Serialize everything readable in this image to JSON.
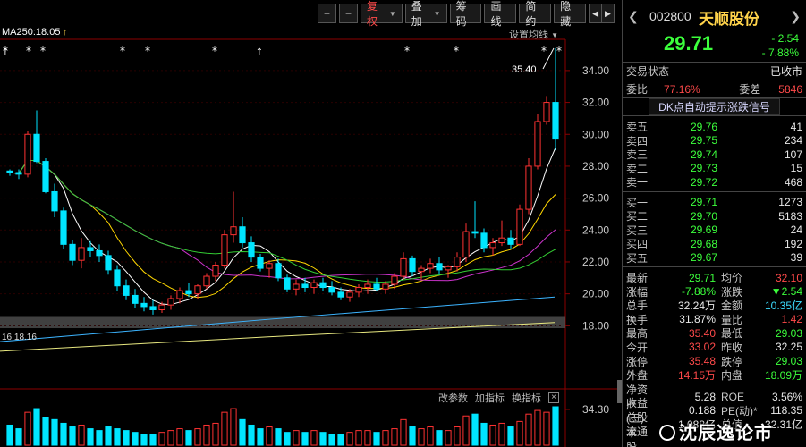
{
  "toolbar": {
    "plus": "+",
    "minus": "−",
    "fuquan": "复权",
    "diejia": "叠加",
    "chouma": "筹码",
    "huaxian": "画线",
    "jianyue": "简约",
    "yincang": "隐藏",
    "prev": "◀",
    "next": "▶"
  },
  "ma": {
    "label": "MA250:18.05",
    "settings": "设置均线"
  },
  "chart_data": {
    "type": "candlestick",
    "ylim": [
      16.0,
      35.9
    ],
    "price_ticks": [
      "34.00",
      "32.00",
      "30.00",
      "28.00",
      "26.00",
      "24.00",
      "22.00",
      "20.00",
      "18.00"
    ],
    "tick_values": [
      34,
      32,
      30,
      28,
      26,
      24,
      22,
      20,
      18
    ],
    "high_annotation": "35.40",
    "low_annotation": "16.18.16",
    "vol_label": "34.30",
    "candles": [
      [
        27.7,
        27.8,
        27.4,
        27.6
      ],
      [
        27.6,
        27.8,
        27.2,
        27.5
      ],
      [
        27.5,
        30.2,
        27.3,
        30.0
      ],
      [
        30.0,
        31.5,
        28.2,
        28.3
      ],
      [
        28.3,
        28.5,
        26.3,
        26.4
      ],
      [
        26.4,
        26.9,
        24.8,
        25.2
      ],
      [
        25.2,
        25.4,
        22.8,
        23.1
      ],
      [
        23.1,
        23.4,
        21.8,
        22.1
      ],
      [
        22.1,
        23.5,
        21.6,
        22.9
      ],
      [
        22.9,
        23.3,
        22.3,
        22.7
      ],
      [
        22.7,
        23.1,
        22.0,
        22.4
      ],
      [
        22.4,
        22.7,
        21.2,
        21.5
      ],
      [
        21.5,
        21.8,
        20.2,
        20.5
      ],
      [
        20.5,
        20.9,
        19.6,
        19.9
      ],
      [
        19.9,
        20.3,
        19.1,
        19.4
      ],
      [
        19.4,
        19.8,
        18.9,
        19.2
      ],
      [
        19.2,
        19.6,
        18.7,
        19.0
      ],
      [
        19.0,
        19.5,
        18.8,
        19.3
      ],
      [
        19.3,
        19.9,
        19.0,
        19.7
      ],
      [
        19.7,
        20.4,
        19.4,
        20.2
      ],
      [
        20.2,
        20.7,
        19.8,
        20.0
      ],
      [
        20.0,
        20.6,
        19.7,
        20.5
      ],
      [
        20.5,
        21.3,
        20.3,
        21.1
      ],
      [
        21.1,
        22.0,
        20.8,
        21.8
      ],
      [
        21.8,
        24.0,
        21.6,
        23.7
      ],
      [
        23.7,
        26.4,
        23.2,
        24.2
      ],
      [
        24.2,
        24.8,
        22.9,
        23.2
      ],
      [
        23.2,
        23.6,
        22.0,
        22.3
      ],
      [
        22.3,
        22.5,
        21.4,
        21.6
      ],
      [
        21.6,
        22.1,
        21.0,
        21.9
      ],
      [
        21.9,
        22.2,
        20.8,
        21.0
      ],
      [
        21.0,
        21.2,
        20.1,
        20.3
      ],
      [
        20.3,
        20.9,
        19.9,
        20.6
      ],
      [
        20.6,
        21.0,
        20.1,
        20.4
      ],
      [
        20.4,
        20.9,
        20.0,
        20.7
      ],
      [
        20.7,
        21.0,
        20.2,
        20.4
      ],
      [
        20.4,
        20.8,
        19.9,
        20.1
      ],
      [
        20.1,
        20.4,
        19.6,
        19.8
      ],
      [
        19.8,
        20.3,
        19.5,
        20.1
      ],
      [
        20.1,
        20.6,
        19.8,
        20.4
      ],
      [
        20.4,
        20.9,
        20.0,
        20.6
      ],
      [
        20.6,
        21.0,
        20.2,
        20.3
      ],
      [
        20.3,
        20.8,
        20.0,
        20.6
      ],
      [
        20.6,
        21.3,
        20.3,
        21.1
      ],
      [
        21.1,
        22.6,
        20.9,
        22.2
      ],
      [
        22.2,
        22.4,
        21.1,
        21.4
      ],
      [
        21.4,
        21.8,
        20.9,
        21.6
      ],
      [
        21.6,
        22.2,
        21.3,
        21.9
      ],
      [
        21.9,
        22.3,
        21.2,
        21.5
      ],
      [
        21.5,
        21.8,
        21.0,
        21.7
      ],
      [
        21.7,
        22.6,
        21.4,
        22.3
      ],
      [
        22.3,
        24.4,
        22.0,
        23.9
      ],
      [
        23.9,
        25.8,
        23.5,
        23.8
      ],
      [
        23.8,
        24.1,
        22.6,
        22.9
      ],
      [
        22.9,
        23.5,
        22.4,
        23.2
      ],
      [
        23.2,
        24.6,
        23.0,
        23.5
      ],
      [
        23.5,
        24.0,
        22.8,
        23.1
      ],
      [
        23.1,
        25.6,
        23.0,
        25.3
      ],
      [
        25.3,
        28.5,
        25.0,
        28.0
      ],
      [
        28.0,
        31.3,
        27.8,
        30.8
      ],
      [
        30.8,
        32.4,
        30.6,
        32.0
      ],
      [
        32.0,
        35.4,
        29.0,
        29.7
      ]
    ],
    "volumes": [
      0.55,
      0.45,
      0.9,
      1.0,
      0.75,
      0.7,
      0.6,
      0.5,
      0.55,
      0.45,
      0.4,
      0.5,
      0.45,
      0.4,
      0.35,
      0.3,
      0.3,
      0.35,
      0.4,
      0.45,
      0.4,
      0.45,
      0.55,
      0.6,
      0.9,
      1.0,
      0.7,
      0.55,
      0.45,
      0.5,
      0.45,
      0.35,
      0.4,
      0.35,
      0.4,
      0.35,
      0.3,
      0.3,
      0.35,
      0.4,
      0.4,
      0.35,
      0.4,
      0.45,
      0.7,
      0.5,
      0.45,
      0.5,
      0.4,
      0.4,
      0.5,
      0.8,
      0.85,
      0.6,
      0.55,
      0.6,
      0.5,
      0.65,
      0.85,
      0.95,
      0.9,
      1.05
    ]
  },
  "vol_toolbar": {
    "gaicanshu": "改参数",
    "jiazhibiao": "加指标",
    "huanzhibiao": "换指标",
    "close": "×"
  },
  "stock": {
    "code": "002800",
    "name": "天顺股份",
    "price": "29.71",
    "change_abs": "- 2.54",
    "change_pct": "- 7.88%"
  },
  "status": {
    "label": "交易状态",
    "value": "已收市",
    "weibi_label": "委比",
    "weibi_value": "77.16%",
    "weicha_label": "委差",
    "weicha_value": "5846"
  },
  "dk_link": "DK点自动提示涨跌信号",
  "sell_orders": [
    {
      "level": "卖五",
      "price": "29.76",
      "vol": "41"
    },
    {
      "level": "卖四",
      "price": "29.75",
      "vol": "234"
    },
    {
      "level": "卖三",
      "price": "29.74",
      "vol": "107"
    },
    {
      "level": "卖二",
      "price": "29.73",
      "vol": "15"
    },
    {
      "level": "卖一",
      "price": "29.72",
      "vol": "468"
    }
  ],
  "buy_orders": [
    {
      "level": "买一",
      "price": "29.71",
      "vol": "1273"
    },
    {
      "level": "买二",
      "price": "29.70",
      "vol": "5183"
    },
    {
      "level": "买三",
      "price": "29.69",
      "vol": "24"
    },
    {
      "level": "买四",
      "price": "29.68",
      "vol": "192"
    },
    {
      "level": "买五",
      "price": "29.67",
      "vol": "39"
    }
  ],
  "quote": [
    {
      "l1": "最新",
      "v1": "29.71",
      "c1": "green",
      "l2": "均价",
      "v2": "32.10",
      "c2": "red"
    },
    {
      "l1": "涨幅",
      "v1": "-7.88%",
      "c1": "green",
      "l2": "涨跌",
      "v2": "▼2.54",
      "c2": "green"
    },
    {
      "l1": "总手",
      "v1": "32.24万",
      "c1": "white",
      "l2": "金额",
      "v2": "10.35亿",
      "c2": "cyan"
    },
    {
      "l1": "换手",
      "v1": "31.87%",
      "c1": "white",
      "l2": "量比",
      "v2": "1.42",
      "c2": "red"
    },
    {
      "l1": "最高",
      "v1": "35.40",
      "c1": "red",
      "l2": "最低",
      "v2": "29.03",
      "c2": "green"
    },
    {
      "l1": "今开",
      "v1": "33.02",
      "c1": "red",
      "l2": "昨收",
      "v2": "32.25",
      "c2": "white"
    },
    {
      "l1": "涨停",
      "v1": "35.48",
      "c1": "red",
      "l2": "跌停",
      "v2": "29.03",
      "c2": "green"
    },
    {
      "l1": "外盘",
      "v1": "14.15万",
      "c1": "red",
      "l2": "内盘",
      "v2": "18.09万",
      "c2": "green"
    },
    {
      "l1": "净资产",
      "v1": "5.28",
      "c1": "white",
      "l2": "ROE",
      "v2": "3.56%",
      "c2": "white"
    },
    {
      "l1": "收益(三)",
      "v1": "0.188",
      "c1": "white",
      "l2": "PE(动)*",
      "v2": "118.35",
      "c2": "white"
    },
    {
      "l1": "总股本",
      "v1": "1.088亿",
      "c1": "white",
      "l2": "总值",
      "v2": "32.31亿",
      "c2": "white"
    },
    {
      "l1": "流通股",
      "v1": "",
      "c1": "white",
      "l2": "",
      "v2": "",
      "c2": "white"
    }
  ],
  "watermark": "沈辰逸论市"
}
